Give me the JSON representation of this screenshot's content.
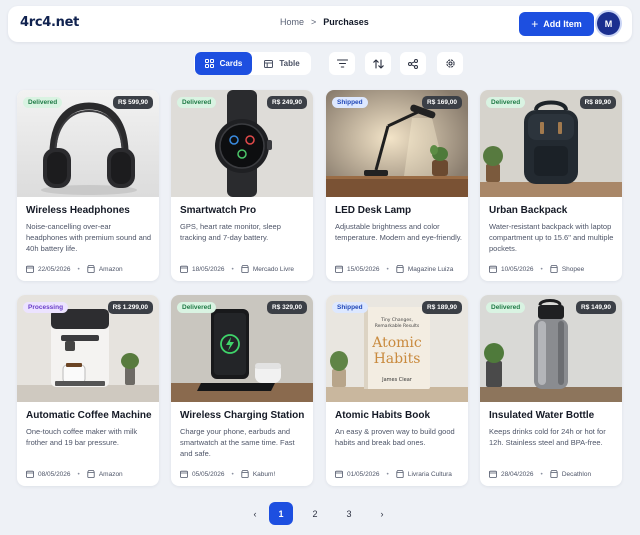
{
  "app": {
    "logo": "4rc4.net"
  },
  "header": {
    "breadcrumb": {
      "home": "Home",
      "separator": ">",
      "current": "Purchases"
    },
    "add_button": {
      "label": "Add Item",
      "icon": "plus-icon"
    },
    "avatar": {
      "initial": "M",
      "color": "#1a2f8f"
    }
  },
  "toolbar": {
    "views": [
      {
        "label": "Cards",
        "icon": "grid-icon",
        "active": true
      },
      {
        "label": "Table",
        "icon": "table-icon",
        "active": false
      }
    ],
    "tools": [
      {
        "name": "filter-icon"
      },
      {
        "name": "sort-icon"
      },
      {
        "name": "share-icon"
      },
      {
        "name": "settings-icon"
      }
    ]
  },
  "colors": {
    "accent": "#1d4fe0",
    "delivered": "#1e7a45",
    "shipped": "#2148b8",
    "processing": "#6a3ec8"
  },
  "products": [
    {
      "status": "Delivered",
      "status_type": "delivered",
      "price": "R$ 599,90",
      "title": "Wireless Headphones",
      "description": "Noise-cancelling over-ear headphones with premium sound and 40h battery life.",
      "date": "22/05/2026",
      "store": "Amazon",
      "image": "headphones"
    },
    {
      "status": "Delivered",
      "status_type": "delivered",
      "price": "R$ 249,90",
      "title": "Smartwatch Pro",
      "description": "GPS, heart rate monitor, sleep tracking and 7-day battery.",
      "date": "18/05/2026",
      "store": "Mercado Livre",
      "image": "smartwatch"
    },
    {
      "status": "Shipped",
      "status_type": "shipped",
      "price": "R$ 169,00",
      "title": "LED Desk Lamp",
      "description": "Adjustable brightness and color temperature. Modern and eye-friendly.",
      "date": "15/05/2026",
      "store": "Magazine Luiza",
      "image": "lamp"
    },
    {
      "status": "Delivered",
      "status_type": "delivered",
      "price": "R$ 89,90",
      "title": "Urban Backpack",
      "description": "Water-resistant backpack with laptop compartment up to 15.6\" and multiple pockets.",
      "date": "10/05/2026",
      "store": "Shopee",
      "image": "backpack"
    },
    {
      "status": "Processing",
      "status_type": "processing",
      "price": "R$ 1.299,00",
      "title": "Automatic Coffee Machine",
      "description": "One-touch coffee maker with milk frother and 19 bar pressure.",
      "date": "08/05/2026",
      "store": "Amazon",
      "image": "coffee"
    },
    {
      "status": "Delivered",
      "status_type": "delivered",
      "price": "R$ 329,00",
      "title": "Wireless Charging Station",
      "description": "Charge your phone, earbuds and smartwatch at the same time. Fast and safe.",
      "date": "05/05/2026",
      "store": "Kabum!",
      "image": "charger"
    },
    {
      "status": "Shipped",
      "status_type": "shipped",
      "price": "R$ 189,90",
      "title": "Atomic Habits Book",
      "description": "An easy & proven way to build good habits and break bad ones.",
      "date": "01/05/2026",
      "store": "Livraria Cultura",
      "image": "book",
      "book_cover": {
        "tagline": "Tiny Changes, Remarkable Results",
        "title_1": "Atomic",
        "title_2": "Habits",
        "author": "James Clear"
      }
    },
    {
      "status": "Delivered",
      "status_type": "delivered",
      "price": "R$ 149,90",
      "title": "Insulated Water Bottle",
      "description": "Keeps drinks cold for 24h or hot for 12h. Stainless steel and BPA-free.",
      "date": "28/04/2026",
      "store": "Decathlon",
      "image": "bottle"
    }
  ],
  "pagination": {
    "prev": "‹",
    "pages": [
      "1",
      "2",
      "3"
    ],
    "current": "1",
    "next": "›"
  }
}
